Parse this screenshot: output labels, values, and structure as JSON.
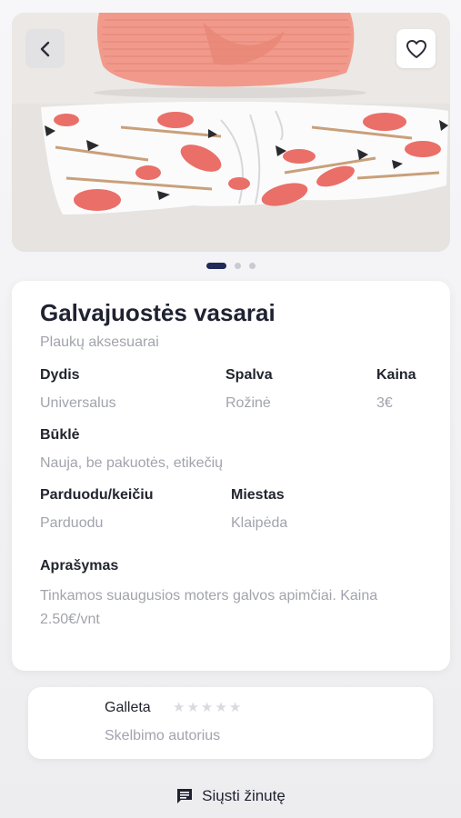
{
  "product": {
    "title": "Galvajuostės vasarai",
    "category": "Plaukų aksesuarai",
    "image_count": 3,
    "active_image": 1
  },
  "specs": {
    "size": {
      "label": "Dydis",
      "value": "Universalus"
    },
    "color": {
      "label": "Spalva",
      "value": "Rožinė"
    },
    "price": {
      "label": "Kaina",
      "value": "3€"
    },
    "condition": {
      "label": "Būklė",
      "value": "Nauja, be pakuotės, etikečių"
    },
    "deal": {
      "label": "Parduodu/keičiu",
      "value": "Parduodu"
    },
    "city": {
      "label": "Miestas",
      "value": "Klaipėda"
    },
    "description": {
      "label": "Aprašymas",
      "value": "Tinkamos suaugusios moters galvos apimčiai. Kaina 2.50€/vnt"
    }
  },
  "author": {
    "name": "Galleta",
    "role": "Skelbimo autorius",
    "rating": 0,
    "rating_max": 5
  },
  "actions": {
    "send_message": "Siųsti žinutę"
  },
  "icons": {
    "back": "chevron-left-icon",
    "favorite": "heart-outline-icon",
    "message": "chat-bubble-icon",
    "star": "star-icon"
  },
  "colors": {
    "accent": "#1f2a56",
    "headband_top": "#f19a8c",
    "flamingo": "#ea6f68"
  }
}
